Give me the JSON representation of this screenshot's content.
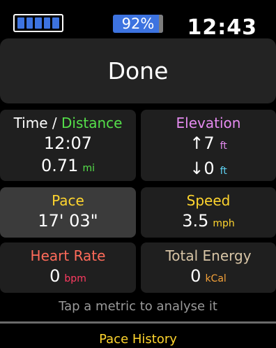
{
  "status_bar": {
    "battery_cells": 5,
    "battery_percent_label": "92%",
    "battery_level": 0.92,
    "time": "12:43"
  },
  "done_button": {
    "label": "Done"
  },
  "metrics": {
    "time_distance": {
      "title_time": "Time",
      "separator": "/",
      "title_distance": "Distance",
      "time_value": "12:07",
      "distance_value": "0.71",
      "distance_unit": "mi"
    },
    "elevation": {
      "title": "Elevation",
      "ascent_symbol": "↑",
      "ascent_value": "7",
      "ascent_unit": "ft",
      "descent_symbol": "↓",
      "descent_value": "0",
      "descent_unit": "ft"
    },
    "pace": {
      "title": "Pace",
      "value": "17' 03\""
    },
    "speed": {
      "title": "Speed",
      "value": "3.5",
      "unit": "mph"
    },
    "heart_rate": {
      "title": "Heart Rate",
      "value": "0",
      "unit": "bpm"
    },
    "total_energy": {
      "title": "Total Energy",
      "value": "0",
      "unit": "kCal"
    }
  },
  "hint": "Tap a metric to analyse it",
  "next_link": "Pace History",
  "colors": {
    "background": "#000000",
    "tile": "#1f1f1f",
    "tile_selected": "#3b3b3b",
    "battery_blue": "#3d73e0",
    "distance_green": "#55e04a",
    "elevation_violet": "#e58bf0",
    "descent_cyan": "#5fd4f5",
    "pace_yellow": "#ffd52e",
    "heart_red": "#ff6b5a",
    "energy_tan": "#d8c5a6"
  }
}
